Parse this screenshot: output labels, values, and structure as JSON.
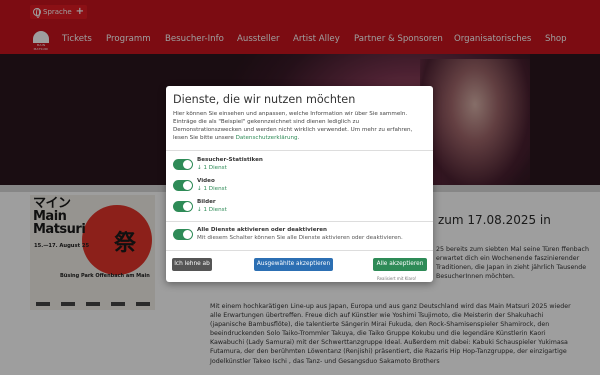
{
  "topbar": {
    "language_label": "Sprache",
    "language_icon": "globe-icon",
    "language_plus": "+"
  },
  "nav": {
    "logo_text": "MAIN MATSURI",
    "items": [
      {
        "label": "Tickets"
      },
      {
        "label": "Programm"
      },
      {
        "label": "Besucher-Info"
      },
      {
        "label": "Aussteller"
      },
      {
        "label": "Artist Alley"
      },
      {
        "label": "Partner & Sponsoren"
      },
      {
        "label": "Organisatorisches"
      },
      {
        "label": "Shop"
      }
    ]
  },
  "poster": {
    "title_line1": "マイン",
    "title_line2": "Main",
    "title_line3": "Matsuri",
    "kanji": "祭",
    "date": "15.—17. August 25",
    "venue": "Büsing Park Offenbach am Main"
  },
  "article": {
    "headline": "zum 17.08.2025 in",
    "side_text": "25 bereits zum siebten Mal seine Türen ffenbach erwartet dich ein Wochenende faszinierender Traditionen, die Japan in zieht jährlich Tausende BesucherInnen möchten.",
    "paragraph": "Mit einem hochkarätigen Line-up aus Japan, Europa und aus ganz Deutschland wird das Main Matsuri 2025 wieder alle Erwartungen übertreffen. Freue dich auf Künstler wie Yoshimi Tsujimoto, die Meisterin der Shakuhachi (japanische Bambusflöte), die talentierte Sängerin Mirai Fukuda, den Rock-Shamisenspieler Shamirock, den beeindruckenden Solo Taiko-Trommler Takuya, die Taiko Gruppe Kokubu und die legendäre Künstlerin Kaori Kawabuchi (Lady Samurai) mit der Schwerttanzgruppe Ideal. Außerdem mit dabei: Kabuki Schauspieler Yukimasa Futamura, der den berühmten Löwentanz (Renjishi) präsentiert, die Razaris Hip Hop-Tanzgruppe, der einzigartige Jodelkünstler Takeo Ischi , das Tanz- und Gesangsduo Sakamoto Brothers"
  },
  "consent": {
    "title": "Dienste, die wir nutzen möchten",
    "description": "Hier können Sie einsehen und anpassen, welche Information wir über Sie sammeln. Einträge die als \"Beispiel\" gekennzeichnet sind dienen lediglich zu Demonstrationszwecken und werden nicht wirklich verwendet. Um mehr zu erfahren, lesen Sie bitte unsere",
    "privacy_link": "Datenschutzerklärung",
    "privacy_suffix": ".",
    "services": [
      {
        "name": "Besucher-Statistiken",
        "count": "↓ 1 Dienst",
        "enabled": true
      },
      {
        "name": "Video",
        "count": "↓ 1 Dienst",
        "enabled": true
      },
      {
        "name": "Bilder",
        "count": "↓ 1 Dienst",
        "enabled": true
      }
    ],
    "toggle_all": {
      "name": "Alle Dienste aktivieren oder deaktivieren",
      "sub": "Mit diesem Schalter können Sie alle Dienste aktivieren oder deaktivieren.",
      "enabled": true
    },
    "decline_label": "Ich lehne ab",
    "accept_selected_label": "Ausgewählte akzeptieren",
    "accept_all_label": "Alle akzeptieren",
    "realized_with": "Realisiert mit Klaro!"
  },
  "colors": {
    "brand_red": "#c8141e",
    "accent_green": "#2e8b57",
    "accent_blue": "#2c6fb3"
  }
}
